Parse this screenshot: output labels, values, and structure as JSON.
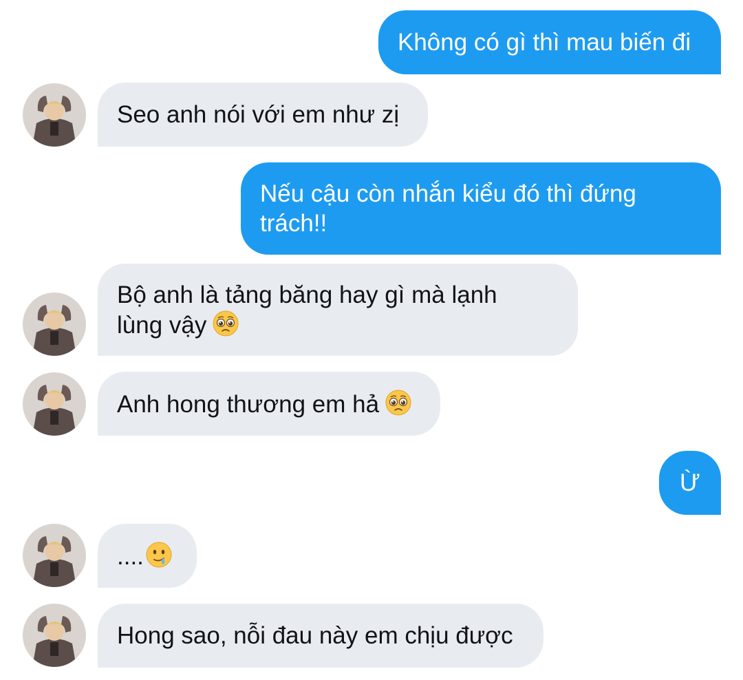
{
  "contact": {
    "avatar_icon": "profile-photo-icon"
  },
  "messages": [
    {
      "from": "me",
      "text": "Không có gì thì mau biến đi"
    },
    {
      "from": "them",
      "text": "Seo anh nói với em như zị"
    },
    {
      "from": "me",
      "text": "Nếu cậu còn nhắn kiểu đó thì đứng\ntrách!!"
    },
    {
      "from": "them",
      "text": "Bộ anh là tảng băng hay gì mà lạnh\nlùng vậy",
      "emoji": "pleading-face-emoji"
    },
    {
      "from": "them",
      "text": "Anh hong thương em hả",
      "emoji": "pleading-face-emoji"
    },
    {
      "from": "me",
      "text": "Ừ"
    },
    {
      "from": "them",
      "text": "....",
      "emoji": "face-holding-back-tears-emoji"
    },
    {
      "from": "them",
      "text": "Hong sao, nỗi đau này em chịu được"
    }
  ],
  "colors": {
    "outgoing_bubble": "#1d9bf0",
    "incoming_bubble": "#e8ecf0",
    "outgoing_text": "#ffffff",
    "incoming_text": "#111318"
  }
}
